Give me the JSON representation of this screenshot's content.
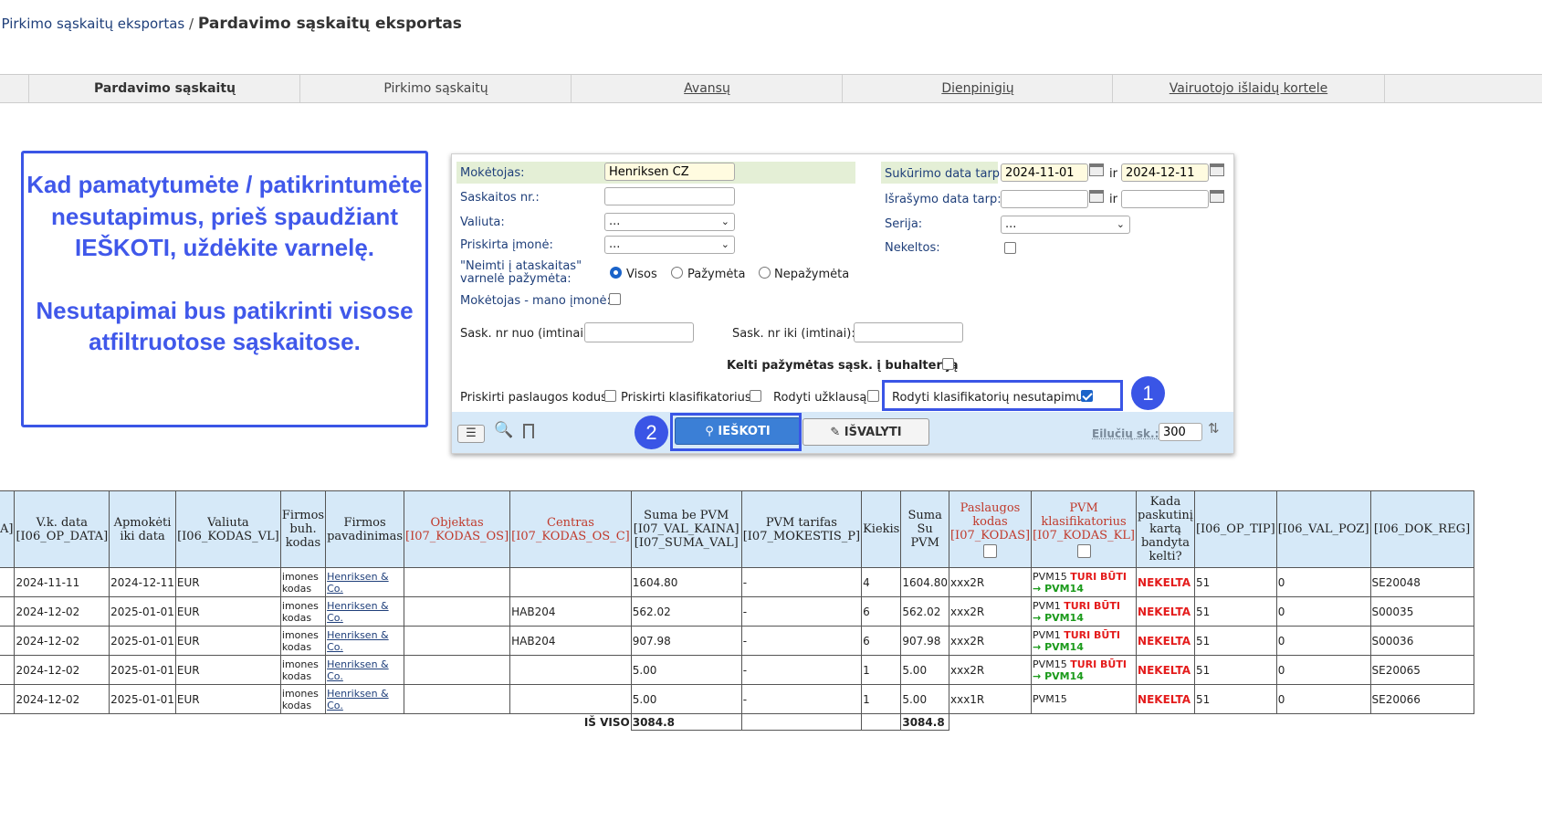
{
  "breadcrumb": {
    "link": "Pirkimo sąskaitų eksportas",
    "separator": "/",
    "current": "Pardavimo sąskaitų eksportas"
  },
  "tabs": [
    {
      "label": "Pardavimo sąskaitų",
      "active": true
    },
    {
      "label": "Pirkimo sąskaitų",
      "active": false
    },
    {
      "label": "Avansų",
      "active": false
    },
    {
      "label": "Dienpinigių",
      "active": false
    },
    {
      "label": "Vairuotojo išlaidų kortele",
      "active": false
    }
  ],
  "note": {
    "paragraph1": "Kad pamatytumėte / patikrintumėte nesutapimus, prieš spaudžiant IEŠKOTI, uždėkite varnelę.",
    "paragraph2": "Nesutapimai bus patikrinti visose atfiltruotose sąskaitose."
  },
  "filters": {
    "moketojas_label": "Mokėtojas:",
    "moketojas_value": "Henriksen CZ",
    "saskaitos_nr_label": "Saskaitos nr.:",
    "saskaitos_nr_value": "",
    "valiuta_label": "Valiuta:",
    "valiuta_value": "...",
    "priskirta_imone_label": "Priskirta įmonė:",
    "priskirta_imone_value": "...",
    "neimti_label_line1": "\"Neimti į ataskaitas\"",
    "neimti_label_line2": "varnelė pažymėta:",
    "radio_visos": "Visos",
    "radio_pazymeta": "Pažymėta",
    "radio_nepazymeta": "Nepažymėta",
    "moketojas_mano_label": "Mokėtojas - mano įmonė:",
    "sask_nuo_label": "Sask. nr nuo (imtinai):",
    "sask_iki_label": "Sask. nr iki (imtinai):",
    "sukurimo_label": "Sukūrimo data tarp:",
    "sukurimo_from": "2024-11-01",
    "sukurimo_to": "2024-12-11",
    "ir": "ir",
    "israsymo_label": "Išrašymo data tarp:",
    "serija_label": "Serija:",
    "serija_value": "...",
    "nekeltos_label": "Nekeltos:",
    "kelti_label": "Kelti pažymėtas sąsk. į buhalteriją",
    "priskirti_paslaugos_label": "Priskirti paslaugos kodus",
    "priskirti_klasif_label": "Priskirti klasifikatorius",
    "rodyti_uzklausa_label": "Rodyti užklausą",
    "rodyti_nesutapimus_label": "Rodyti klasifikatorių nesutapimus"
  },
  "toolbar": {
    "search_label": "IEŠKOTI",
    "clear_label": "IŠVALYTI",
    "rows_label": "Eilučių sk.:",
    "rows_value": "300"
  },
  "badges": {
    "one": "1",
    "two": "2"
  },
  "table": {
    "headers": [
      "A]",
      "V.k. data [I06_OP_DATA]",
      "Apmokėti iki data",
      "Valiuta [I06_KODAS_VL]",
      "Firmos buh. kodas",
      "Firmos pavadinimas",
      "Objektas [I07_KODAS_OS]",
      "Centras [I07_KODAS_OS_C]",
      "Suma be PVM [I07_VAL_KAINA] [I07_SUMA_VAL]",
      "PVM tarifas [I07_MOKESTIS_P]",
      "Kiekis",
      "Suma Su PVM",
      "Paslaugos kodas [I07_KODAS]",
      "PVM klasifikatorius [I07_KODAS_KL]",
      "Kada paskutinį kartą bandyta kelti?",
      "[I06_OP_TIP]",
      "[I06_VAL_POZ]",
      "[I06_DOK_REG]"
    ],
    "rows": [
      {
        "vk_data": "2024-11-11",
        "apmoketi": "2024-12-11",
        "valiuta": "EUR",
        "buh1": "imones",
        "buh2": "kodas",
        "firma1": "Henriksen &",
        "firma2": "Co.",
        "objektas": "",
        "centras": "",
        "suma_be": "1604.80",
        "tarifas": "-",
        "kiekis": "4",
        "suma_su": "1604.80",
        "paslaugos": "xxx2R",
        "pvm_code": "PVM15",
        "must": "TURI BŪTI",
        "target": "→ PVM14",
        "kada": "NEKELTA",
        "op_tip": "51",
        "val_poz": "0",
        "dok_reg": "SE20048"
      },
      {
        "vk_data": "2024-12-02",
        "apmoketi": "2025-01-01",
        "valiuta": "EUR",
        "buh1": "imones",
        "buh2": "kodas",
        "firma1": "Henriksen &",
        "firma2": "Co.",
        "objektas": "",
        "centras": "HAB204",
        "suma_be": "562.02",
        "tarifas": "-",
        "kiekis": "6",
        "suma_su": "562.02",
        "paslaugos": "xxx2R",
        "pvm_code": "PVM1",
        "must": "TURI BŪTI",
        "target": "→ PVM14",
        "kada": "NEKELTA",
        "op_tip": "51",
        "val_poz": "0",
        "dok_reg": "S00035"
      },
      {
        "vk_data": "2024-12-02",
        "apmoketi": "2025-01-01",
        "valiuta": "EUR",
        "buh1": "imones",
        "buh2": "kodas",
        "firma1": "Henriksen &",
        "firma2": "Co.",
        "objektas": "",
        "centras": "HAB204",
        "suma_be": "907.98",
        "tarifas": "-",
        "kiekis": "6",
        "suma_su": "907.98",
        "paslaugos": "xxx2R",
        "pvm_code": "PVM1",
        "must": "TURI BŪTI",
        "target": "→ PVM14",
        "kada": "NEKELTA",
        "op_tip": "51",
        "val_poz": "0",
        "dok_reg": "S00036"
      },
      {
        "vk_data": "2024-12-02",
        "apmoketi": "2025-01-01",
        "valiuta": "EUR",
        "buh1": "imones",
        "buh2": "kodas",
        "firma1": "Henriksen &",
        "firma2": "Co.",
        "objektas": "",
        "centras": "",
        "suma_be": "5.00",
        "tarifas": "-",
        "kiekis": "1",
        "suma_su": "5.00",
        "paslaugos": "xxx2R",
        "pvm_code": "PVM15",
        "must": "TURI BŪTI",
        "target": "→ PVM14",
        "kada": "NEKELTA",
        "op_tip": "51",
        "val_poz": "0",
        "dok_reg": "SE20065"
      },
      {
        "vk_data": "2024-12-02",
        "apmoketi": "2025-01-01",
        "valiuta": "EUR",
        "buh1": "imones",
        "buh2": "kodas",
        "firma1": "Henriksen &",
        "firma2": "Co.",
        "objektas": "",
        "centras": "",
        "suma_be": "5.00",
        "tarifas": "-",
        "kiekis": "1",
        "suma_su": "5.00",
        "paslaugos": "xxx1R",
        "pvm_code": "PVM15",
        "must": "",
        "target": "",
        "kada": "NEKELTA",
        "op_tip": "51",
        "val_poz": "0",
        "dok_reg": "SE20066"
      }
    ],
    "total_label": "IŠ VISO",
    "total_suma_be": "3084.8",
    "total_suma_su": "3084.8"
  },
  "colors": {
    "accent": "#3a55e6",
    "header_bg": "#d6e9f8",
    "error": "#e41b1b",
    "ok": "#1a9a1a"
  }
}
